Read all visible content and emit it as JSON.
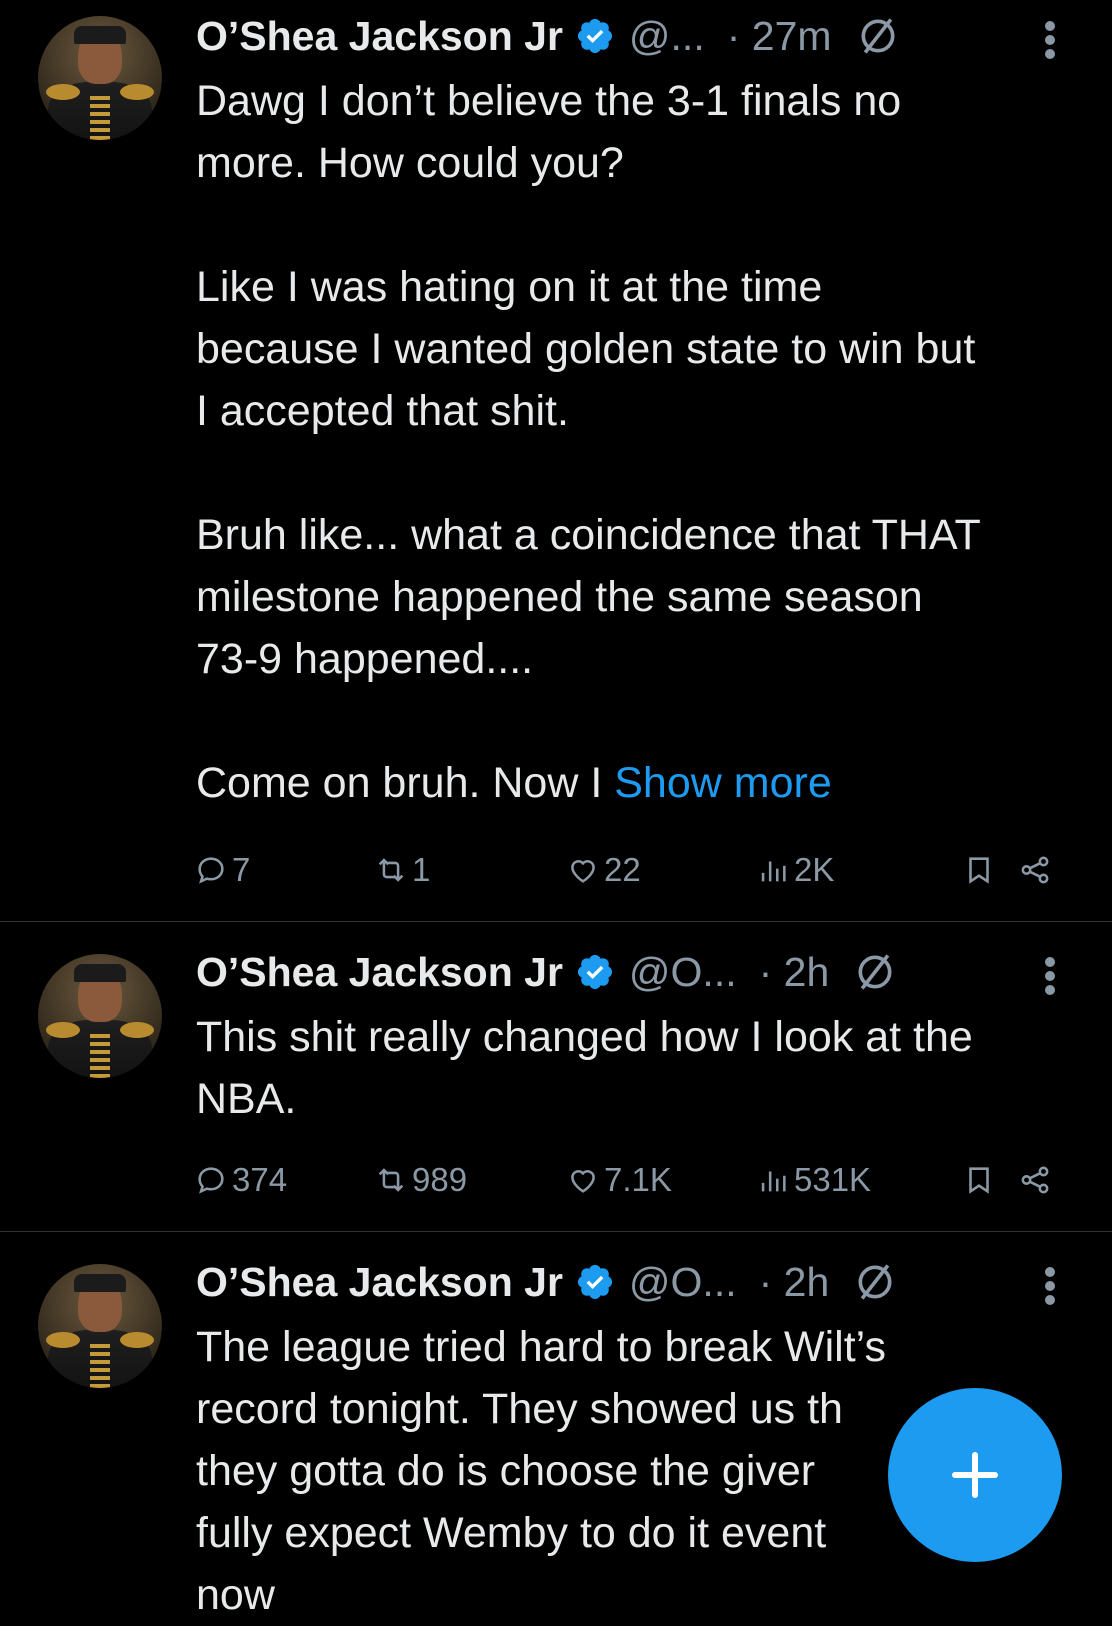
{
  "tweets": [
    {
      "name": "O’Shea Jackson Jr",
      "handle": "@...",
      "time": "· 27m",
      "lines": [
        "Dawg I don’t believe the 3-1 finals no",
        "more. How could you?",
        "",
        "Like I was hating on it at the time",
        "because I wanted golden state to win but",
        "I accepted that shit.",
        "",
        "Bruh like... what a coincidence that THAT",
        "milestone happened the same season",
        "73-9 happened....",
        ""
      ],
      "last_line": "Come on bruh. Now I ",
      "show_more": "Show more",
      "replies": "7",
      "reposts": "1",
      "likes": "22",
      "views": "2K"
    },
    {
      "name": "O’Shea Jackson Jr",
      "handle": "@O...",
      "time": "· 2h",
      "lines": [
        "This shit really changed how I look at the",
        "NBA."
      ],
      "replies": "374",
      "reposts": "989",
      "likes": "7.1K",
      "views": "531K"
    },
    {
      "name": "O’Shea Jackson Jr",
      "handle": "@O...",
      "time": "· 2h",
      "lines": [
        "The league tried hard to break Wilt’s",
        "record tonight. They showed us th",
        "they gotta do is choose the giver",
        "fully expect Wemby to do it event",
        "now"
      ]
    }
  ],
  "icons": {
    "verified": "verified-badge-icon",
    "grok": "grok-icon",
    "more": "more-options-icon",
    "reply": "reply-icon",
    "repost": "repost-icon",
    "like": "like-icon",
    "views": "views-icon",
    "bookmark": "bookmark-icon",
    "share": "share-icon",
    "compose": "compose-plus-icon"
  },
  "colors": {
    "accent": "#1d9bf0",
    "background": "#000000",
    "text": "#e7e9ea",
    "secondary": "#8b98a5"
  }
}
